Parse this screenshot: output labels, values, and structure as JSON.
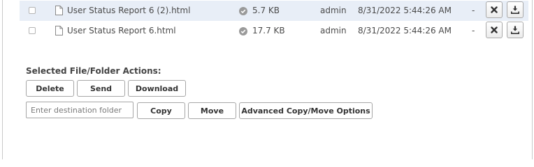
{
  "files": [
    {
      "name": "User Status Report 6 (2).html",
      "size": "5.7 KB",
      "owner": "admin",
      "date": "8/31/2022 5:44:26 AM",
      "extra": "-",
      "selected": false
    },
    {
      "name": "User Status Report 6.html",
      "size": "17.7 KB",
      "owner": "admin",
      "date": "8/31/2022 5:44:26 AM",
      "extra": "-",
      "selected": false
    }
  ],
  "actions": {
    "label": "Selected File/Folder Actions:",
    "delete": "Delete",
    "send": "Send",
    "download": "Download",
    "destination_placeholder": "Enter destination folder",
    "destination_value": "",
    "copy": "Copy",
    "move": "Move",
    "advanced": "Advanced Copy/Move Options"
  },
  "colors": {
    "highlight_row": "#e8eef7",
    "status_icon": "#9a9a9a"
  },
  "icons": {
    "file": "file-icon",
    "status": "check-circle-icon",
    "delete": "close-x-icon",
    "download": "download-icon"
  }
}
